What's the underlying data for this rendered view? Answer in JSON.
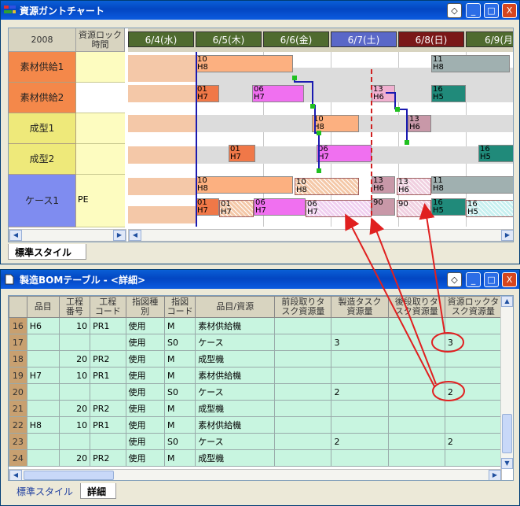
{
  "gantt_window": {
    "title": "資源ガントチャート",
    "year": "2008",
    "lock_header": "資源ロック\n時間",
    "dates": [
      {
        "label": "6/4(水)",
        "color": "#4f6b2f"
      },
      {
        "label": "6/5(木)",
        "color": "#4f6b2f"
      },
      {
        "label": "6/6(金)",
        "color": "#4f6b2f"
      },
      {
        "label": "6/7(土)",
        "color": "#5a68c8"
      },
      {
        "label": "6/8(日)",
        "color": "#7a1818"
      },
      {
        "label": "6/9(月",
        "color": "#4f6b2f"
      }
    ],
    "resources": [
      {
        "name": "素材供給1",
        "lock": ""
      },
      {
        "name": "素材供給2",
        "lock": ""
      },
      {
        "name": "成型1",
        "lock": ""
      },
      {
        "name": "成型2",
        "lock": ""
      },
      {
        "name": "ケース1",
        "lock": "PE"
      }
    ],
    "bar_labels": {
      "b1": [
        "10",
        "H8"
      ],
      "b2": [
        "11",
        "H8"
      ],
      "b3": [
        "01",
        "H7"
      ],
      "b4": [
        "06",
        "H7"
      ],
      "b5": [
        "13",
        "H6"
      ],
      "b6": [
        "16",
        "H5"
      ],
      "b7": [
        "10",
        "H8"
      ],
      "b8": [
        "13",
        "H6"
      ],
      "b9": [
        "01",
        "H7"
      ],
      "b10": [
        "06",
        "H7"
      ],
      "b11": [
        "16",
        "H5"
      ],
      "b12": [
        "10",
        "H8"
      ],
      "b13": [
        "10",
        "H8"
      ],
      "b14": [
        "13",
        "H6"
      ],
      "b15": [
        "13",
        "H6"
      ],
      "b16": [
        "11",
        "H8"
      ],
      "b17": [
        "01",
        "H7"
      ],
      "b18": [
        "01",
        "H7"
      ],
      "b19": [
        "06",
        "H7"
      ],
      "b20": [
        "06",
        "H7"
      ],
      "b21": [
        "90"
      ],
      "b22": [
        "90"
      ],
      "b23": [
        "16",
        "H5"
      ],
      "b24": [
        "16",
        "H5"
      ]
    },
    "tab_label": "標準スタイル"
  },
  "bom_window": {
    "title": "製造BOMテーブル - <詳細>",
    "columns": [
      "品目",
      "工程\n番号",
      "工程\nコード",
      "指図種\n別",
      "指図\nコード",
      "品目/資源",
      "前段取りタ\nスク資源量",
      "製造タスク\n資源量",
      "後段取りタ\nスク資源量",
      "資源ロックタ\nスク資源量"
    ],
    "rows": [
      {
        "n": "16",
        "item": "H6",
        "pno": "10",
        "pcode": "PR1",
        "kind": "使用",
        "code": "M",
        "res": "素材供給機",
        "pre": "",
        "mfg": "",
        "post": "",
        "lock": ""
      },
      {
        "n": "17",
        "item": "",
        "pno": "",
        "pcode": "",
        "kind": "使用",
        "code": "S0",
        "res": "ケース",
        "pre": "",
        "mfg": "3",
        "post": "",
        "lock": "3"
      },
      {
        "n": "18",
        "item": "",
        "pno": "20",
        "pcode": "PR2",
        "kind": "使用",
        "code": "M",
        "res": "成型機",
        "pre": "",
        "mfg": "",
        "post": "",
        "lock": ""
      },
      {
        "n": "19",
        "item": "H7",
        "pno": "10",
        "pcode": "PR1",
        "kind": "使用",
        "code": "M",
        "res": "素材供給機",
        "pre": "",
        "mfg": "",
        "post": "",
        "lock": ""
      },
      {
        "n": "20",
        "item": "",
        "pno": "",
        "pcode": "",
        "kind": "使用",
        "code": "S0",
        "res": "ケース",
        "pre": "",
        "mfg": "2",
        "post": "",
        "lock": "2"
      },
      {
        "n": "21",
        "item": "",
        "pno": "20",
        "pcode": "PR2",
        "kind": "使用",
        "code": "M",
        "res": "成型機",
        "pre": "",
        "mfg": "",
        "post": "",
        "lock": ""
      },
      {
        "n": "22",
        "item": "H8",
        "pno": "10",
        "pcode": "PR1",
        "kind": "使用",
        "code": "M",
        "res": "素材供給機",
        "pre": "",
        "mfg": "",
        "post": "",
        "lock": ""
      },
      {
        "n": "23",
        "item": "",
        "pno": "",
        "pcode": "",
        "kind": "使用",
        "code": "S0",
        "res": "ケース",
        "pre": "",
        "mfg": "2",
        "post": "",
        "lock": "2"
      },
      {
        "n": "24",
        "item": "",
        "pno": "20",
        "pcode": "PR2",
        "kind": "使用",
        "code": "M",
        "res": "成型機",
        "pre": "",
        "mfg": "",
        "post": "",
        "lock": ""
      }
    ],
    "tabs": [
      "標準スタイル",
      "詳細"
    ]
  },
  "controls": {
    "minimize": "_",
    "maximize": "□",
    "close": "X",
    "style": "◇"
  }
}
